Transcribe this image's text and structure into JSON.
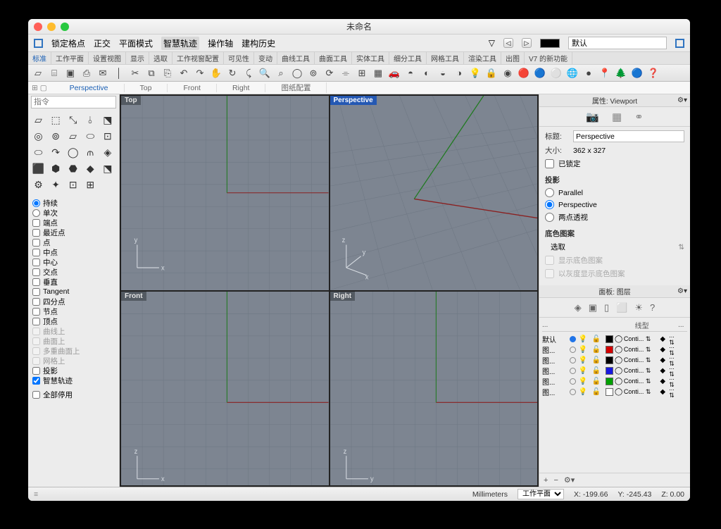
{
  "title": "未命名",
  "menubar": [
    "锁定格点",
    "正交",
    "平面模式",
    "智慧轨迹",
    "操作轴",
    "建构历史"
  ],
  "defaultLayer": "默认",
  "tabbars": {
    "row1": [
      "标准",
      "工作平面",
      "设置视图",
      "显示",
      "选取",
      "工作视窗配置",
      "可见性",
      "变动",
      "曲线工具",
      "曲面工具",
      "实体工具",
      "细分工具",
      "网格工具",
      "渲染工具",
      "出图",
      "V7 的新功能"
    ]
  },
  "toolbarIcons": [
    "▱",
    "⌸",
    "▣",
    "⎙",
    "✉",
    "│",
    "✂",
    "⧉",
    "⎘",
    "↶",
    "↷",
    "✋",
    "↻",
    "⤹",
    "🔍",
    "⌕",
    "◯",
    "⊚",
    "⟳",
    "⌯",
    "⊞",
    "▦",
    "🚗",
    "◓",
    "◐",
    "◒",
    "◑",
    "💡",
    "🔒",
    "◉",
    "🔴",
    "🔵",
    "⚪",
    "🌐",
    "●",
    "📍",
    "🌲",
    "🔵",
    "❓"
  ],
  "vtabs": {
    "items": [
      "Perspective",
      "Top",
      "Front",
      "Right",
      "图纸配置"
    ],
    "activeIndex": 0
  },
  "viewportLabels": [
    "Top",
    "Perspective",
    "Front",
    "Right"
  ],
  "cmd": {
    "placeholder": "指令"
  },
  "toolgrid": [
    "▱",
    "⬚",
    "⤡",
    "⫰",
    "⬔",
    "◎",
    "⊚",
    "▱",
    "⬭",
    "⊡",
    "⬭",
    "↷",
    "◯",
    "⫙",
    "◈",
    "⬛",
    "⬢",
    "⬣",
    "◆",
    "⬔",
    "⚙",
    "✦",
    "⊡",
    "⊞"
  ],
  "osnap": {
    "radios": [
      {
        "label": "持续",
        "checked": true
      },
      {
        "label": "单次",
        "checked": false
      }
    ],
    "checks": [
      {
        "label": "端点",
        "checked": false,
        "disabled": false
      },
      {
        "label": "最近点",
        "checked": false,
        "disabled": false
      },
      {
        "label": "点",
        "checked": false,
        "disabled": false
      },
      {
        "label": "中点",
        "checked": false,
        "disabled": false
      },
      {
        "label": "中心",
        "checked": false,
        "disabled": false
      },
      {
        "label": "交点",
        "checked": false,
        "disabled": false
      },
      {
        "label": "垂直",
        "checked": false,
        "disabled": false
      },
      {
        "label": "Tangent",
        "checked": false,
        "disabled": false
      },
      {
        "label": "四分点",
        "checked": false,
        "disabled": false
      },
      {
        "label": "节点",
        "checked": false,
        "disabled": false
      },
      {
        "label": "顶点",
        "checked": false,
        "disabled": false
      },
      {
        "label": "曲线上",
        "checked": false,
        "disabled": true
      },
      {
        "label": "曲面上",
        "checked": false,
        "disabled": true
      },
      {
        "label": "多重曲面上",
        "checked": false,
        "disabled": true
      },
      {
        "label": "网格上",
        "checked": false,
        "disabled": true
      },
      {
        "label": "投影",
        "checked": false,
        "disabled": false
      },
      {
        "label": "智慧轨迹",
        "checked": true,
        "disabled": false
      }
    ],
    "disableAll": {
      "label": "全部停用",
      "checked": false
    }
  },
  "props": {
    "header": "属性: Viewport",
    "titleLabel": "标题:",
    "titleValue": "Perspective",
    "sizeLabel": "大小:",
    "sizeValue": "362 x 327",
    "locked": {
      "label": "已锁定",
      "checked": false
    },
    "projSection": "投影",
    "proj": [
      {
        "label": "Parallel",
        "checked": false
      },
      {
        "label": "Perspective",
        "checked": true
      },
      {
        "label": "两点透视",
        "checked": false
      }
    ],
    "bgSection": "底色图案",
    "bgSelect": "选取",
    "bgShow": {
      "label": "显示底色图案"
    },
    "bgGray": {
      "label": "以灰度显示底色图案"
    }
  },
  "layers": {
    "header": "面板: 图层",
    "cols": [
      "...",
      "",
      "",
      "",
      "",
      "线型",
      "",
      "..."
    ],
    "defaultName": "默认",
    "otherName": "图...",
    "lt": "Conti...",
    "rows": [
      {
        "name": "默认",
        "current": true,
        "on": true,
        "lock": false,
        "color": "#000000",
        "print": "#000000"
      },
      {
        "name": "图...",
        "current": false,
        "on": true,
        "lock": false,
        "color": "#d40000",
        "print": "#d40000"
      },
      {
        "name": "图...",
        "current": false,
        "on": true,
        "lock": false,
        "color": "#000000",
        "print": "#000000"
      },
      {
        "name": "图...",
        "current": false,
        "on": true,
        "lock": false,
        "color": "#1818e0",
        "print": "#1818e0"
      },
      {
        "name": "图...",
        "current": false,
        "on": true,
        "lock": false,
        "color": "#00a000",
        "print": "#00a000"
      },
      {
        "name": "图...",
        "current": false,
        "on": true,
        "lock": false,
        "color": "#ffffff",
        "print": "#000000"
      }
    ]
  },
  "status": {
    "units": "Millimeters",
    "cplane": "工作平面",
    "x": "X: -199.66",
    "y": "Y: -245.43",
    "z": "Z: 0.00"
  }
}
